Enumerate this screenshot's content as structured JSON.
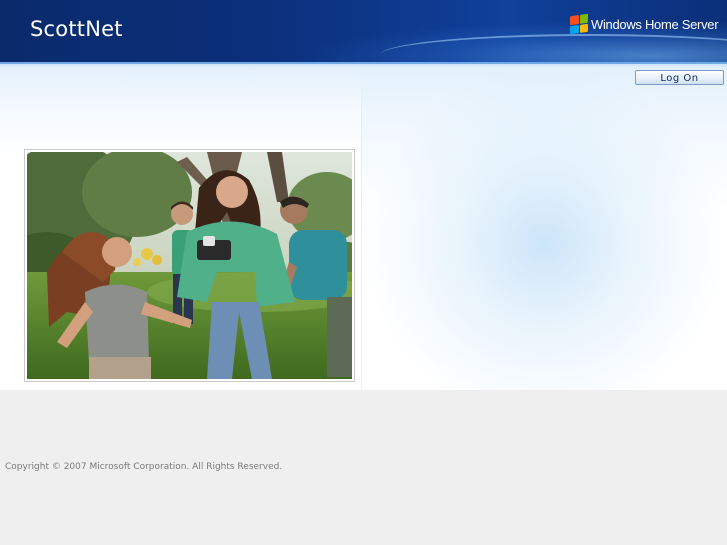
{
  "header": {
    "site_title": "ScottNet",
    "brand": "Windows Home Server",
    "logo_icon": "windows-logo-icon"
  },
  "toolbar": {
    "logon_label": "Log On"
  },
  "photo": {
    "icon": "family-photo"
  },
  "footer": {
    "copyright": "Copyright © 2007 Microsoft Corporation. All Rights Reserved."
  },
  "colors": {
    "header_dark": "#0a2a6b",
    "header_accent": "#6fa9e6",
    "button_text": "#0b2a5a",
    "footer_bg": "#efefef",
    "footer_text": "#7a7a7a"
  }
}
